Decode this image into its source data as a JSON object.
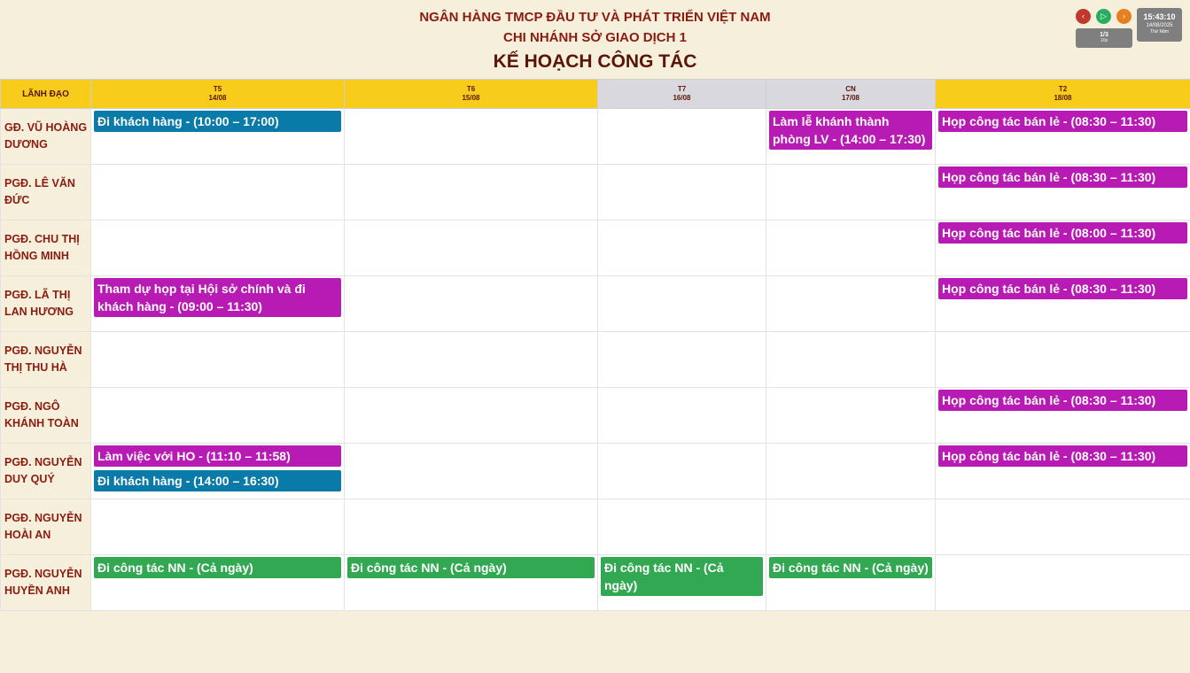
{
  "header": {
    "line1": "NGÂN HÀNG TMCP ĐẦU TƯ VÀ PHÁT TRIỂN VIỆT NAM",
    "line2": "CHI NHÁNH SỞ GIAO DỊCH 1",
    "title": "KẾ HOẠCH CÔNG TÁC"
  },
  "controls": {
    "prev_icon": "chevron-left-icon",
    "play_icon": "play-icon",
    "next_icon": "chevron-right-icon",
    "prev_glyph": "‹",
    "play_glyph": "▷",
    "next_glyph": "›",
    "page": "1/3",
    "interval": "10s"
  },
  "clock": {
    "time": "15:43:10",
    "date": "14/08/2025",
    "weekday": "Thứ Năm"
  },
  "colors": {
    "blue": "#0a7aa8",
    "magenta": "#b81bb3",
    "green": "#33a852",
    "header_yellow": "#f7cc1b",
    "weekend_gray": "#d8d8de"
  },
  "table": {
    "leader_header": "LÃNH ĐẠO",
    "days": [
      {
        "day": "T5",
        "date": "14/08",
        "weekend": false
      },
      {
        "day": "T6",
        "date": "15/08",
        "weekend": false
      },
      {
        "day": "T7",
        "date": "16/08",
        "weekend": true
      },
      {
        "day": "CN",
        "date": "17/08",
        "weekend": true
      },
      {
        "day": "T2",
        "date": "18/08",
        "weekend": false
      }
    ],
    "rows": [
      {
        "leader": "GĐ. VŨ HOÀNG DƯƠNG",
        "cells": [
          [
            {
              "text": "Đi khách hàng - (10:00 – 17:00)",
              "color": "#0a7aa8"
            }
          ],
          [],
          [],
          [
            {
              "text": "Làm lễ khánh thành phòng LV - (14:00 – 17:30)",
              "color": "#b81bb3"
            }
          ],
          [
            {
              "text": "Họp công tác bán lẻ - (08:30 – 11:30)",
              "color": "#b81bb3"
            }
          ]
        ]
      },
      {
        "leader": "PGĐ. LÊ VĂN ĐỨC",
        "cells": [
          [],
          [],
          [],
          [],
          [
            {
              "text": "Họp công tác bán lẻ - (08:30 – 11:30)",
              "color": "#b81bb3"
            }
          ]
        ]
      },
      {
        "leader": "PGĐ. CHU THỊ HỒNG MINH",
        "cells": [
          [],
          [],
          [],
          [],
          [
            {
              "text": "Họp công tác bán lẻ - (08:00 – 11:30)",
              "color": "#b81bb3"
            }
          ]
        ]
      },
      {
        "leader": "PGĐ. LÃ THỊ LAN HƯƠNG",
        "cells": [
          [
            {
              "text": "Tham dự họp tại Hội sở chính và đi khách hàng - (09:00 – 11:30)",
              "color": "#b81bb3"
            }
          ],
          [],
          [],
          [],
          [
            {
              "text": "Họp công tác bán lẻ - (08:30 – 11:30)",
              "color": "#b81bb3"
            }
          ]
        ]
      },
      {
        "leader": "PGĐ. NGUYỄN THỊ THU HÀ",
        "cells": [
          [],
          [],
          [],
          [],
          []
        ]
      },
      {
        "leader": "PGĐ. NGÔ KHÁNH TOÀN",
        "cells": [
          [],
          [],
          [],
          [],
          [
            {
              "text": "Họp công tác bán lẻ - (08:30 – 11:30)",
              "color": "#b81bb3"
            }
          ]
        ]
      },
      {
        "leader": "PGĐ. NGUYỄN DUY QUÝ",
        "cells": [
          [
            {
              "text": "Làm việc với HO - (11:10 – 11:58)",
              "color": "#b81bb3"
            },
            {
              "text": "Đi khách hàng - (14:00 – 16:30)",
              "color": "#0a7aa8"
            }
          ],
          [],
          [],
          [],
          [
            {
              "text": "Họp công tác bán lẻ - (08:30 – 11:30)",
              "color": "#b81bb3"
            }
          ]
        ]
      },
      {
        "leader": "PGĐ. NGUYỄN HOÀI AN",
        "cells": [
          [],
          [],
          [],
          [],
          []
        ]
      },
      {
        "leader": "PGĐ. NGUYỄN HUYỀN ANH",
        "cells": [
          [
            {
              "text": "Đi công tác NN - (Cả ngày)",
              "color": "#33a852"
            }
          ],
          [
            {
              "text": "Đi công tác NN - (Cả ngày)",
              "color": "#33a852"
            }
          ],
          [
            {
              "text": "Đi công tác NN - (Cả ngày)",
              "color": "#33a852"
            }
          ],
          [
            {
              "text": "Đi công tác NN - (Cả ngày)",
              "color": "#33a852"
            }
          ],
          []
        ]
      }
    ]
  }
}
